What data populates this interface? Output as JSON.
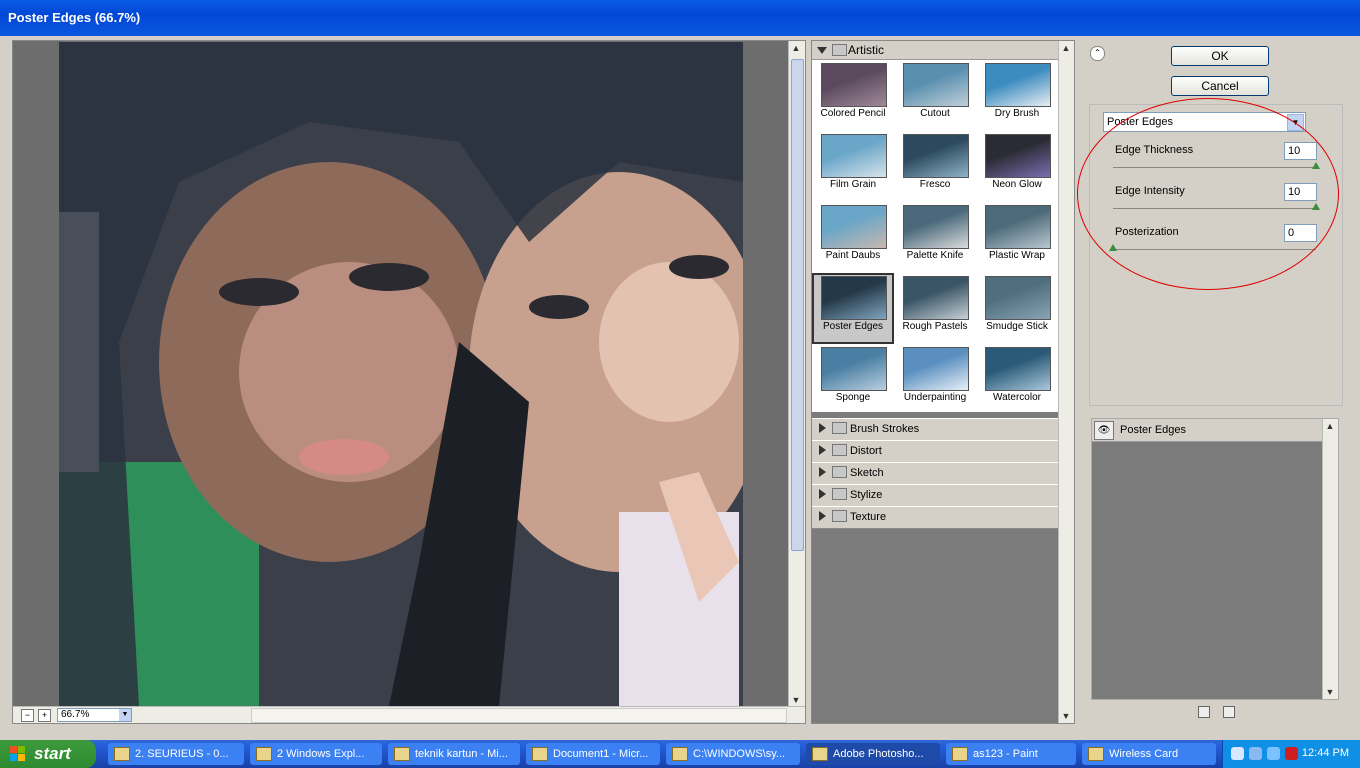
{
  "window": {
    "title": "Poster Edges (66.7%)"
  },
  "preview": {
    "zoom": "66.7%"
  },
  "gallery": {
    "open_category": "Artistic",
    "filters": [
      {
        "label": "Colored Pencil"
      },
      {
        "label": "Cutout"
      },
      {
        "label": "Dry Brush"
      },
      {
        "label": "Film Grain"
      },
      {
        "label": "Fresco"
      },
      {
        "label": "Neon Glow"
      },
      {
        "label": "Paint Daubs"
      },
      {
        "label": "Palette Knife"
      },
      {
        "label": "Plastic Wrap"
      },
      {
        "label": "Poster Edges"
      },
      {
        "label": "Rough Pastels"
      },
      {
        "label": "Smudge Stick"
      },
      {
        "label": "Sponge"
      },
      {
        "label": "Underpainting"
      },
      {
        "label": "Watercolor"
      }
    ],
    "selected": "Poster Edges",
    "categories": [
      "Brush Strokes",
      "Distort",
      "Sketch",
      "Stylize",
      "Texture"
    ]
  },
  "buttons": {
    "ok": "OK",
    "cancel": "Cancel"
  },
  "settings": {
    "filter": "Poster Edges",
    "params": [
      {
        "label": "Edge Thickness",
        "value": "10",
        "level": 1.0
      },
      {
        "label": "Edge Intensity",
        "value": "10",
        "level": 1.0
      },
      {
        "label": "Posterization",
        "value": "0",
        "level": 0.0
      }
    ]
  },
  "layers": {
    "items": [
      "Poster Edges"
    ]
  },
  "taskbar": {
    "start": "start",
    "tasks": [
      {
        "label": "2. SEURIEUS - 0..."
      },
      {
        "label": "2 Windows Expl..."
      },
      {
        "label": "teknik kartun - Mi..."
      },
      {
        "label": "Document1 - Micr..."
      },
      {
        "label": "C:\\WINDOWS\\sy..."
      },
      {
        "label": "Adobe Photosho..."
      },
      {
        "label": "as123 - Paint"
      },
      {
        "label": "Wireless Card"
      }
    ],
    "active_task": "Adobe Photosho...",
    "clock": "12:44 PM"
  },
  "colors": {
    "title_bar": "#0a5ce8",
    "highlight_ellipse": "#e00000",
    "taskbar": "#245edb",
    "start": "#3c9a3c"
  }
}
